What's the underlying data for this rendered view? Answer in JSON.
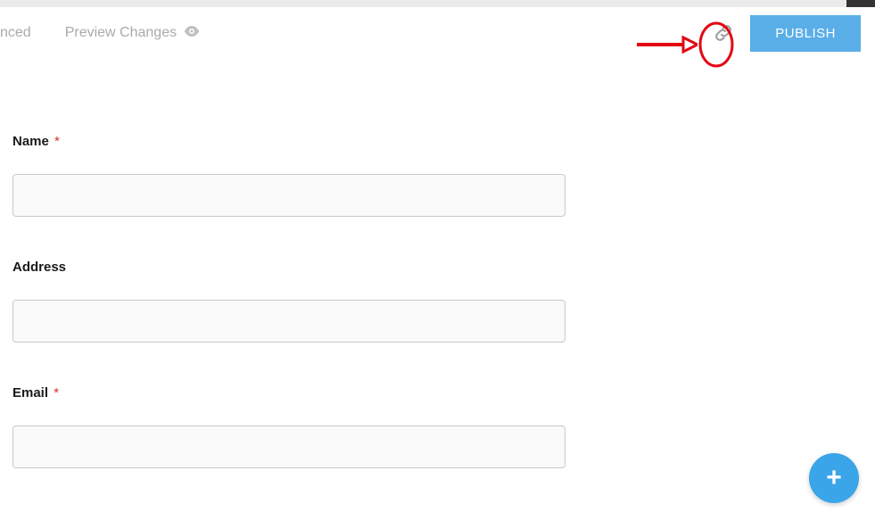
{
  "toolbar": {
    "partial_tab": "nced",
    "preview_label": "Preview Changes",
    "publish_label": "PUBLISH"
  },
  "form": {
    "fields": [
      {
        "label": "Name",
        "required": true
      },
      {
        "label": "Address",
        "required": false
      },
      {
        "label": "Email",
        "required": true
      }
    ],
    "required_marker": "*"
  },
  "fab": {
    "plus": "+"
  }
}
